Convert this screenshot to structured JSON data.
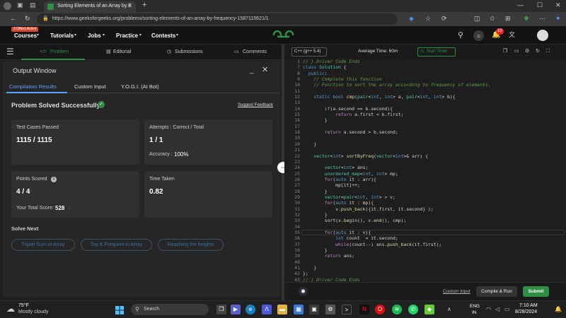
{
  "browser": {
    "tab_title": "Sorting Elements of an Array by F",
    "url": "https://www.geeksforgeeks.org/problems/sorting-elements-of-an-array-by-frequency-1587115621/1"
  },
  "nav": {
    "offers_badge": "3 Offers Active",
    "items": [
      "Courses",
      "Tutorials",
      "Jobs",
      "Practice",
      "Contests"
    ],
    "notif_count": "10"
  },
  "left_tabs": [
    "Problem",
    "Editorial",
    "Submissions",
    "Comments"
  ],
  "output": {
    "title": "Output Window",
    "tabs": [
      "Compilation Results",
      "Custom Input",
      "Y.O.G.I. (AI Bot)"
    ],
    "status": "Problem Solved Successfully",
    "feedback": "Suggest Feedback",
    "cards": {
      "test_label": "Test Cases Passed",
      "test_value": "1115 / 1115",
      "attempts_label": "Attempts : Correct / Total",
      "attempts_value": "1 / 1",
      "accuracy_label": "Accuracy :",
      "accuracy_value": "100%",
      "points_label": "Points Scored",
      "points_value": "4 / 4",
      "total_label": "Your Total Score:",
      "total_value": "528",
      "time_label": "Time Taken",
      "time_value": "0.82"
    },
    "solve_next": "Solve Next",
    "suggestions": [
      "Triplet Sum in Array",
      "Top K Frequent in Array",
      "Reaching the heights"
    ]
  },
  "editor": {
    "language": "C++ (g++ 5.4)",
    "avg_time": "Average Time: 60m",
    "timer": "Start Timer",
    "custom_input": "Custom Input",
    "compile": "Compile & Run",
    "submit": "Submit"
  },
  "taskbar": {
    "weather_temp": "75°F",
    "weather_desc": "Mostly cloudy",
    "search": "Search",
    "lang_top": "ENG",
    "lang_bottom": "IN",
    "time": "7:10 AM",
    "date": "8/28/2024"
  },
  "colors": {
    "accent_green": "#2f8d46",
    "link_blue": "#3d6f9e",
    "bg": "#1f1f1f"
  }
}
